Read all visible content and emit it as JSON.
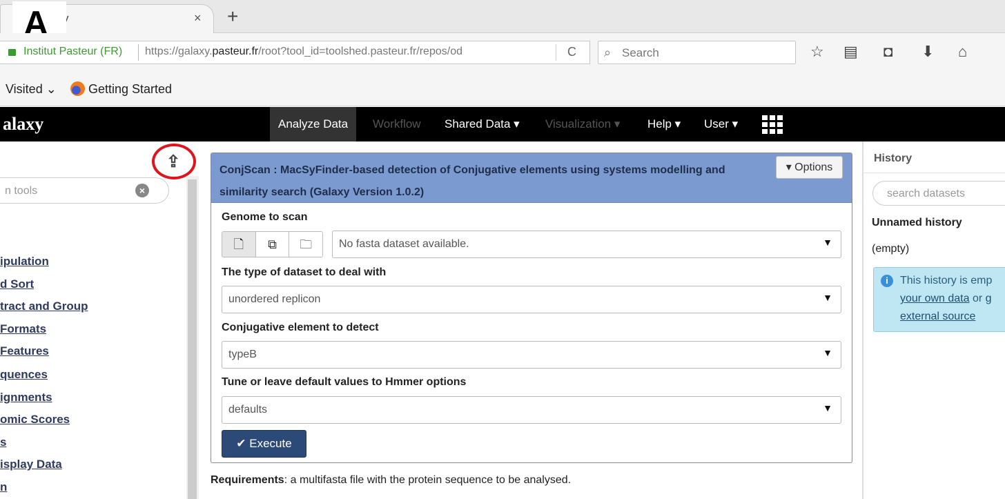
{
  "figure_label": "A",
  "browser": {
    "tab_title": "y",
    "tab_close": "×",
    "new_tab": "+",
    "identity": "Institut Pasteur (FR)",
    "url_prefix": "https://galaxy.",
    "url_domain": "pasteur.fr",
    "url_rest": "/root?tool_id=toolshed.pasteur.fr/repos/od",
    "reload_icon": "C",
    "search_placeholder": "Search",
    "bookmarks": {
      "visited": "Visited",
      "getting_started": "Getting Started"
    }
  },
  "masthead": {
    "brand": "alaxy",
    "items": {
      "analyze": "Analyze Data",
      "workflow": "Workflow",
      "shared": "Shared Data ▾",
      "visualization": "Visualization ▾",
      "help": "Help ▾",
      "user": "User ▾"
    }
  },
  "tool_panel": {
    "search_placeholder": "n tools",
    "sections": [
      "ipulation",
      "d Sort",
      "tract and Group",
      " Formats",
      "Features",
      "quences",
      "ignments",
      "omic Scores",
      "s",
      "isplay Data",
      "n"
    ]
  },
  "tool_form": {
    "title": "ConjScan : MacSyFinder-based detection of Conjugative elements using systems modelling and similarity search (Galaxy Version 1.0.2)",
    "options_label": "▾ Options",
    "genome_label": "Genome to scan",
    "genome_value": "No fasta dataset available.",
    "type_label": "The type of dataset to deal with",
    "type_value": "unordered replicon",
    "element_label": "Conjugative element to detect",
    "element_value": "typeB",
    "hmmer_label": "Tune or leave default values to Hmmer options",
    "hmmer_value": "defaults",
    "execute_label": "✔ Execute",
    "requirements_bold": "Requirements",
    "requirements_text": ": a multifasta file with the protein sequence to be analysed."
  },
  "history": {
    "title": "History",
    "search_placeholder": "search datasets",
    "name": "Unnamed history",
    "size": "(empty)",
    "info_line1": "This history is emp",
    "info_link1": "your own data",
    "info_mid": " or ",
    "info_link1b": "g",
    "info_link2": "external source"
  }
}
